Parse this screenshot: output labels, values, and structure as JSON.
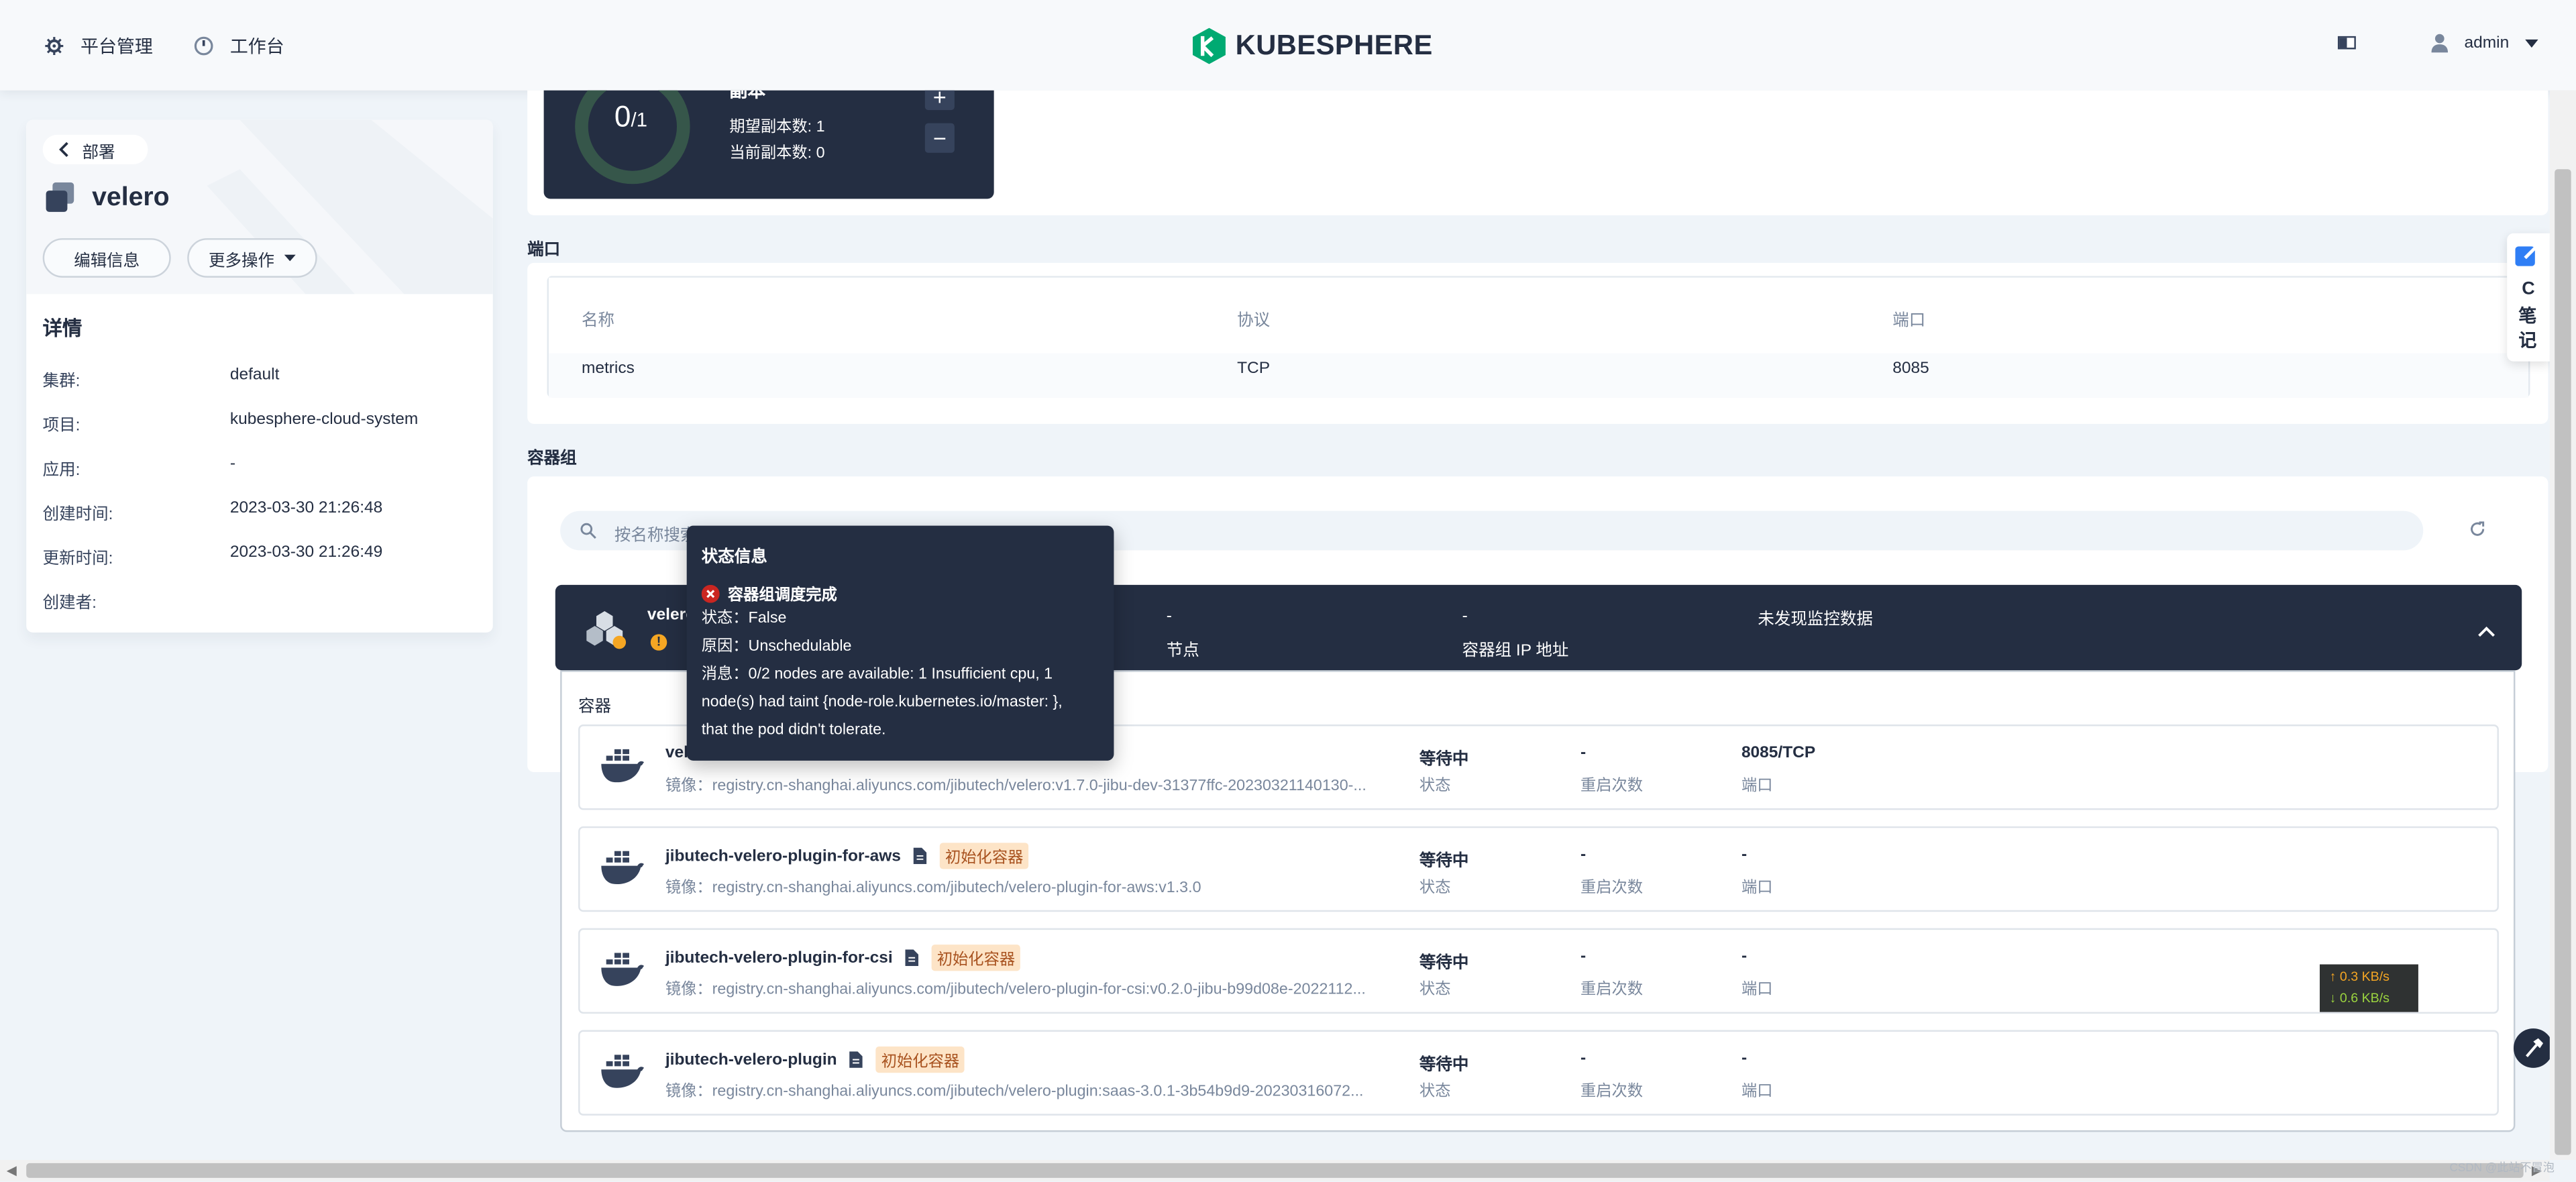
{
  "header": {
    "platform": "平台管理",
    "workbench": "工作台",
    "logo_text": "KUBESPHERE",
    "user": "admin"
  },
  "left": {
    "back_label": "部署",
    "name": "velero",
    "edit_button": "编辑信息",
    "more_button": "更多操作",
    "details_title": "详情",
    "details": [
      {
        "k": "集群:",
        "v": "default"
      },
      {
        "k": "项目:",
        "v": "kubesphere-cloud-system"
      },
      {
        "k": "应用:",
        "v": "-"
      },
      {
        "k": "创建时间:",
        "v": "2023-03-30 21:26:48"
      },
      {
        "k": "更新时间:",
        "v": "2023-03-30 21:26:49"
      },
      {
        "k": "创建者:",
        "v": ""
      }
    ]
  },
  "replica": {
    "count": "0",
    "total": "/1",
    "title": "副本",
    "desired": "期望副本数: 1",
    "current": "当前副本数: 0",
    "plus": "+",
    "minus": "−"
  },
  "ports": {
    "section": "端口",
    "headers": [
      "名称",
      "协议",
      "端口"
    ],
    "row": [
      "metrics",
      "TCP",
      "8085"
    ]
  },
  "pods": {
    "section": "容器组",
    "search_placeholder": "按名称搜索",
    "pod_name": "velero",
    "node_value": "-",
    "node_label": "节点",
    "ip_value": "-",
    "ip_label": "容器组 IP 地址",
    "monitor": "未发现监控数据",
    "containers_label": "容器"
  },
  "containers": [
    {
      "name": "velero",
      "image": "镜像：registry.cn-shanghai.aliyuncs.com/jibutech/velero:v1.7.0-jibu-dev-31377ffc-20230321140130-...",
      "tag": "",
      "status": "等待中",
      "status_label": "状态",
      "restarts": "-",
      "restarts_label": "重启次数",
      "port": "8085/TCP",
      "port_label": "端口"
    },
    {
      "name": "jibutech-velero-plugin-for-aws",
      "image": "镜像：registry.cn-shanghai.aliyuncs.com/jibutech/velero-plugin-for-aws:v1.3.0",
      "tag": "初始化容器",
      "status": "等待中",
      "status_label": "状态",
      "restarts": "-",
      "restarts_label": "重启次数",
      "port": "-",
      "port_label": "端口"
    },
    {
      "name": "jibutech-velero-plugin-for-csi",
      "image": "镜像：registry.cn-shanghai.aliyuncs.com/jibutech/velero-plugin-for-csi:v0.2.0-jibu-b99d08e-2022112...",
      "tag": "初始化容器",
      "status": "等待中",
      "status_label": "状态",
      "restarts": "-",
      "restarts_label": "重启次数",
      "port": "-",
      "port_label": "端口"
    },
    {
      "name": "jibutech-velero-plugin",
      "image": "镜像：registry.cn-shanghai.aliyuncs.com/jibutech/velero-plugin:saas-3.0.1-3b54b9d9-20230316072...",
      "tag": "初始化容器",
      "status": "等待中",
      "status_label": "状态",
      "restarts": "-",
      "restarts_label": "重启次数",
      "port": "-",
      "port_label": "端口"
    }
  ],
  "tooltip": {
    "title": "状态信息",
    "condition": "容器组调度完成",
    "status": "状态：False",
    "reason": "原因：Unschedulable",
    "message1": "消息：0/2 nodes are available: 1 Insufficient cpu, 1",
    "message2": "node(s) had taint {node-role.kubernetes.io/master: },",
    "message3": "that the pod didn't tolerate."
  },
  "network": {
    "up": "↑ 0.3 KB/s",
    "down": "↓ 0.6 KB/s"
  },
  "side_note": {
    "c": "C",
    "l1": "笔",
    "l2": "记"
  },
  "watermark": "CSDN @此站不冒泡",
  "colors": {
    "dark": "#242e42",
    "accent": "#00aa72",
    "tag_bg": "#fde4c7",
    "tag_fg": "#a8521f",
    "error": "#ca2621",
    "warning": "#f5a623"
  }
}
